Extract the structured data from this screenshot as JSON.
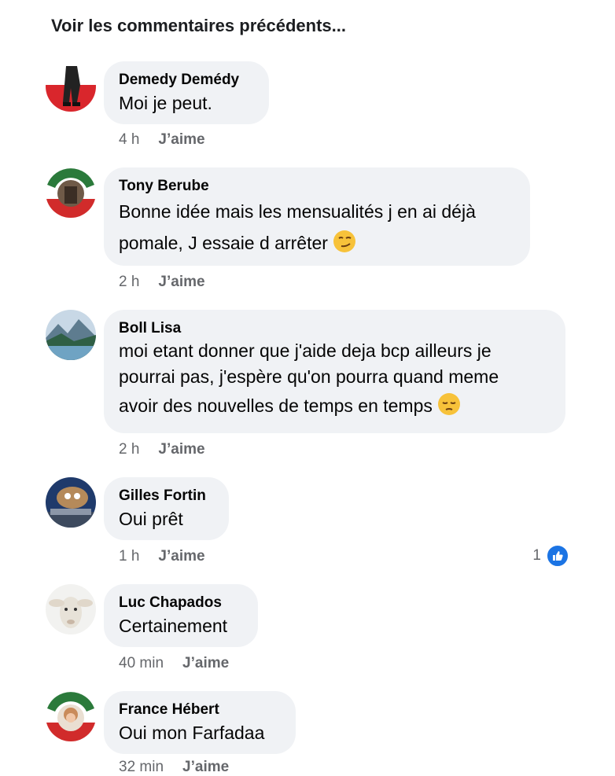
{
  "previous_comments_label": "Voir les commentaires précédents...",
  "comments": [
    {
      "author": "Demedy Demédy",
      "lines": [
        "Moi je peut."
      ],
      "time": "4 h",
      "like_label": "J’aime"
    },
    {
      "author": "Tony Berube",
      "lines": [
        "Bonne idée mais les mensualités j en ai déjà",
        "pomale, J essaie d arrêter"
      ],
      "time": "2 h",
      "like_label": "J’aime"
    },
    {
      "author": "Boll Lisa",
      "lines": [
        "moi etant donner que j'aide deja bcp ailleurs je",
        "pourrai pas, j'espère qu'on pourra quand meme",
        "avoir des nouvelles de temps en temps"
      ],
      "time": "2 h",
      "like_label": "J’aime"
    },
    {
      "author": "Gilles Fortin",
      "lines": [
        "Oui prêt"
      ],
      "time": "1 h",
      "like_label": "J’aime",
      "reaction_count": "1"
    },
    {
      "author": "Luc Chapados",
      "lines": [
        "Certainement"
      ],
      "time": "40 min",
      "like_label": "J’aime"
    },
    {
      "author": "France Hébert",
      "lines": [
        "Oui mon Farfadaa"
      ],
      "time": "32 min",
      "like_label": "J’aime"
    }
  ],
  "colors": {
    "bubble": "#f0f2f5",
    "meta": "#65676b",
    "like_blue": "#1b74e4"
  }
}
